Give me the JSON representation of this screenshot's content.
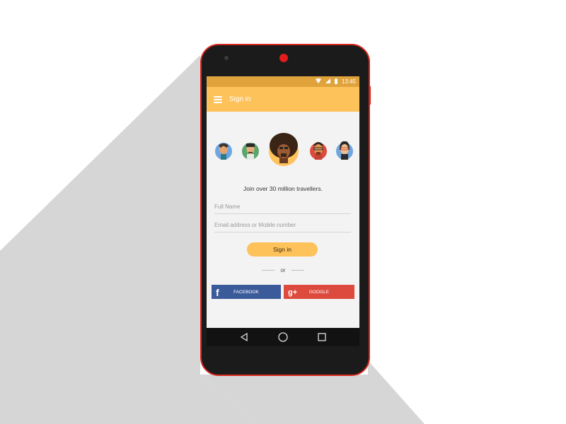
{
  "status_bar": {
    "time": "13:45"
  },
  "app_bar": {
    "title": "Sign in"
  },
  "main": {
    "tagline": "Join over 30 million travellers.",
    "full_name_placeholder": "Full Name",
    "email_placeholder": "Email address or Mobile number",
    "signin_label": "Sign in",
    "or_label": "or",
    "facebook_label": "FACEBOOK",
    "google_label": "GOOGLE",
    "facebook_icon_glyph": "f",
    "google_icon_glyph": "g+"
  },
  "colors": {
    "accent": "#fec25a",
    "status_bar": "#e0a33c",
    "facebook": "#3b5a9a",
    "google": "#dd4b3e",
    "phone_frame": "#d8281e"
  },
  "icons": [
    "menu-icon",
    "wifi-icon",
    "signal-icon",
    "battery-icon",
    "back-icon",
    "home-icon",
    "recents-icon",
    "facebook-icon",
    "google-plus-icon"
  ]
}
